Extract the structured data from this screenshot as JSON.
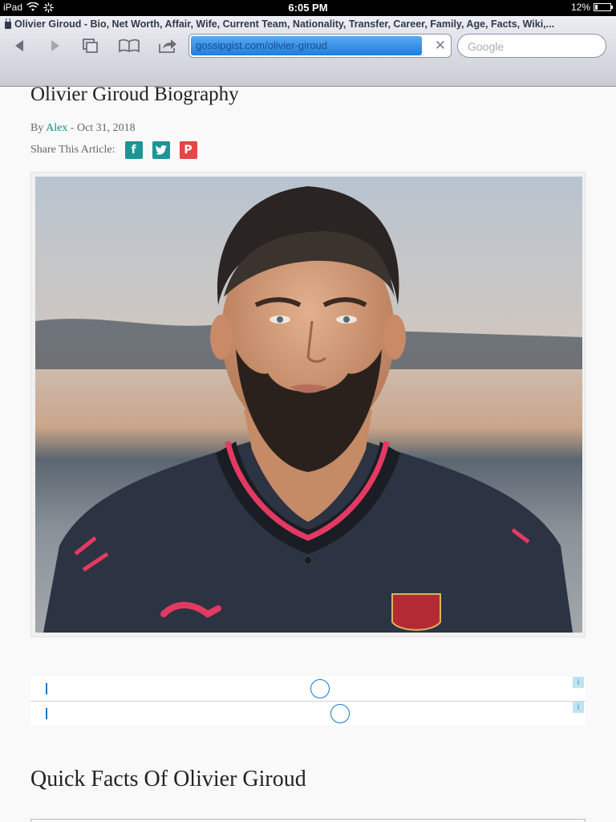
{
  "status": {
    "device": "iPad",
    "time": "6:05 PM",
    "battery": "12%"
  },
  "browser": {
    "tab_title": "Olivier Giroud - Bio, Net Worth, Affair, Wife, Current Team, Nationality, Transfer, Career, Family, Age, Facts, Wiki,...",
    "url": "gossipgist.com/olivier-giroud",
    "search_placeholder": "Google"
  },
  "article": {
    "title": "Olivier Giroud Biography",
    "by_prefix": "By",
    "author": "Alex",
    "date": "- Oct 31, 2018",
    "share_label": "Share This Article:",
    "section_title": "Quick Facts Of Olivier Giroud"
  },
  "colors": {
    "accent": "#1e9496",
    "pinterest": "#e54646",
    "selection": "#1d7de0"
  },
  "icons": [
    "back-icon",
    "forward-icon",
    "tabs-icon",
    "bookmarks-icon",
    "share-icon",
    "clear-icon",
    "facebook-icon",
    "twitter-icon",
    "pinterest-icon",
    "ad-info-icon"
  ]
}
